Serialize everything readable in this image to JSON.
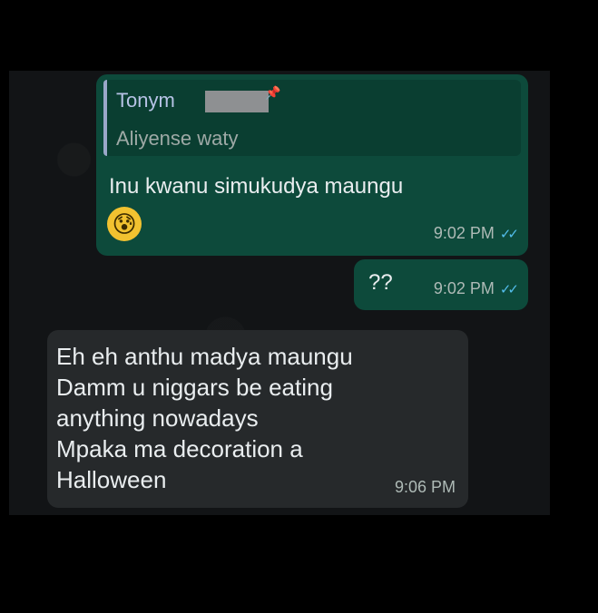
{
  "messages": [
    {
      "direction": "outgoing",
      "quote": {
        "sender": "Tonym",
        "text": "Aliyense waty"
      },
      "text": "Inu kwanu simukudya maungu",
      "emoji": "😰",
      "time": "9:02 PM",
      "status_icon": "read-ticks-icon"
    },
    {
      "direction": "outgoing",
      "text": "??",
      "time": "9:02 PM",
      "status_icon": "read-ticks-icon"
    },
    {
      "direction": "incoming",
      "lines": [
        "Eh eh anthu madya maungu",
        "Damm u niggars be eating",
        "anything nowadays",
        "Mpaka ma decoration a",
        "Halloween"
      ],
      "time": "9:06 PM"
    }
  ],
  "colors": {
    "outgoing_bubble": "#0d4a3b",
    "incoming_bubble": "#26292b",
    "read_ticks": "#53bdeb"
  }
}
